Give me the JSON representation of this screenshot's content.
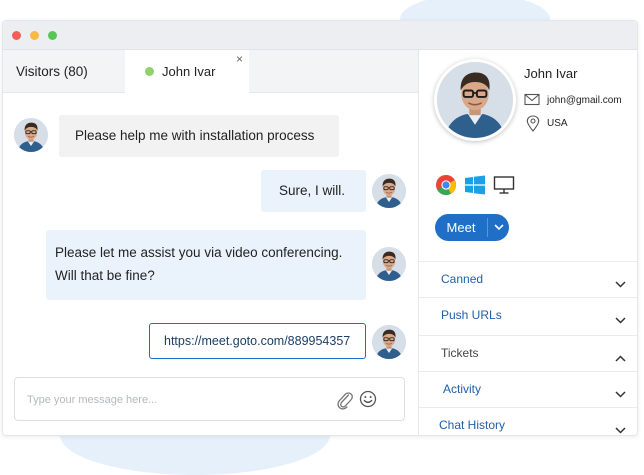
{
  "tabs": {
    "visitors": "Visitors (80)",
    "active": "John Ivar",
    "close": "×"
  },
  "messages": [
    {
      "from": "visitor",
      "text": "Please help me with installation process"
    },
    {
      "from": "agent",
      "text": "Sure, I will."
    },
    {
      "from": "agent",
      "text": "Please let me assist you via video conferencing. Will that be fine?",
      "line1": "Please let me assist you via video conferencing.",
      "line2": "Will that be fine?"
    },
    {
      "from": "agent",
      "text": "https://meet.goto.com/889954357"
    }
  ],
  "composer": {
    "placeholder": "Type your message here...",
    "attach_icon": "paperclip-icon",
    "emoji_icon": "smiley-icon"
  },
  "profile": {
    "name": "John Ivar",
    "email": "john@gmail.com",
    "location": "USA",
    "icons": [
      "chrome-icon",
      "windows-icon",
      "desktop-icon"
    ]
  },
  "meet_button": {
    "label": "Meet"
  },
  "accordion": [
    {
      "label": "Canned",
      "state": "collapsed"
    },
    {
      "label": "Push URLs",
      "state": "collapsed"
    },
    {
      "label": "Tickets",
      "state": "expanded"
    },
    {
      "label": "Activity",
      "state": "collapsed"
    },
    {
      "label": "Chat History",
      "state": "collapsed"
    }
  ],
  "colors": {
    "accent": "#1f6fc6",
    "online": "#8fd26a",
    "agent_bubble": "#eaf3fc",
    "visitor_bubble": "#f2f2f3"
  }
}
